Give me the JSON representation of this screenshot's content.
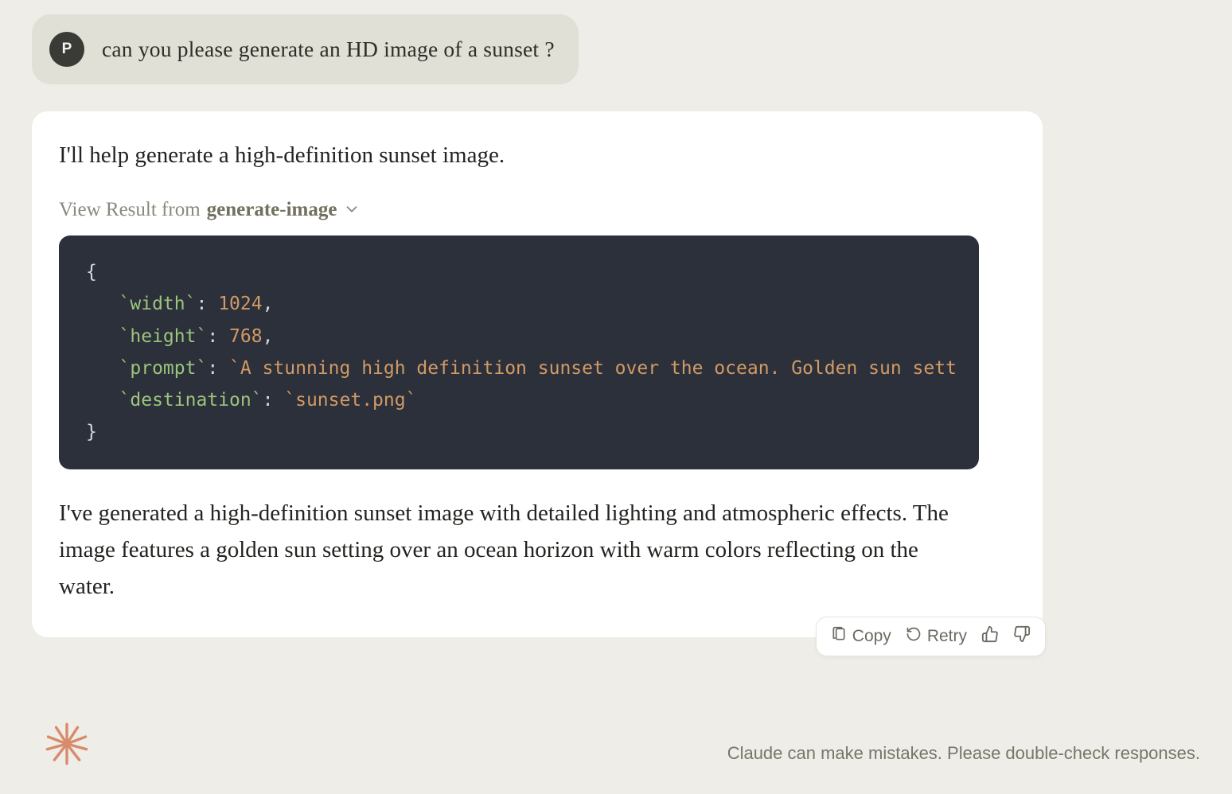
{
  "user": {
    "avatar_letter": "P",
    "message": "can you please generate an HD image of a sunset ?"
  },
  "assistant": {
    "intro": "I'll help generate a high-definition sunset image.",
    "view_result_prefix": "View Result from ",
    "tool_name": "generate-image",
    "code": {
      "brace_open": "{",
      "indent": "   ",
      "lines": [
        {
          "key": "`width`",
          "sep": ": ",
          "value": "1024",
          "value_class": "c-num",
          "trail": ","
        },
        {
          "key": "`height`",
          "sep": ": ",
          "value": "768",
          "value_class": "c-num",
          "trail": ","
        },
        {
          "key": "`prompt`",
          "sep": ": ",
          "value": "`A stunning high definition sunset over the ocean. Golden sun sett",
          "value_class": "c-str",
          "trail": ""
        },
        {
          "key": "`destination`",
          "sep": ": ",
          "value": "`sunset.png`",
          "value_class": "c-str",
          "trail": ""
        }
      ],
      "brace_close": "}"
    },
    "outro": "I've generated a high-definition sunset image with detailed lighting and atmospheric effects. The image features a golden sun setting over an ocean horizon with warm colors reflecting on the water."
  },
  "actions": {
    "copy": "Copy",
    "retry": "Retry"
  },
  "disclaimer": "Claude can make mistakes. Please double-check responses.",
  "colors": {
    "starburst": "#d88a6b"
  }
}
